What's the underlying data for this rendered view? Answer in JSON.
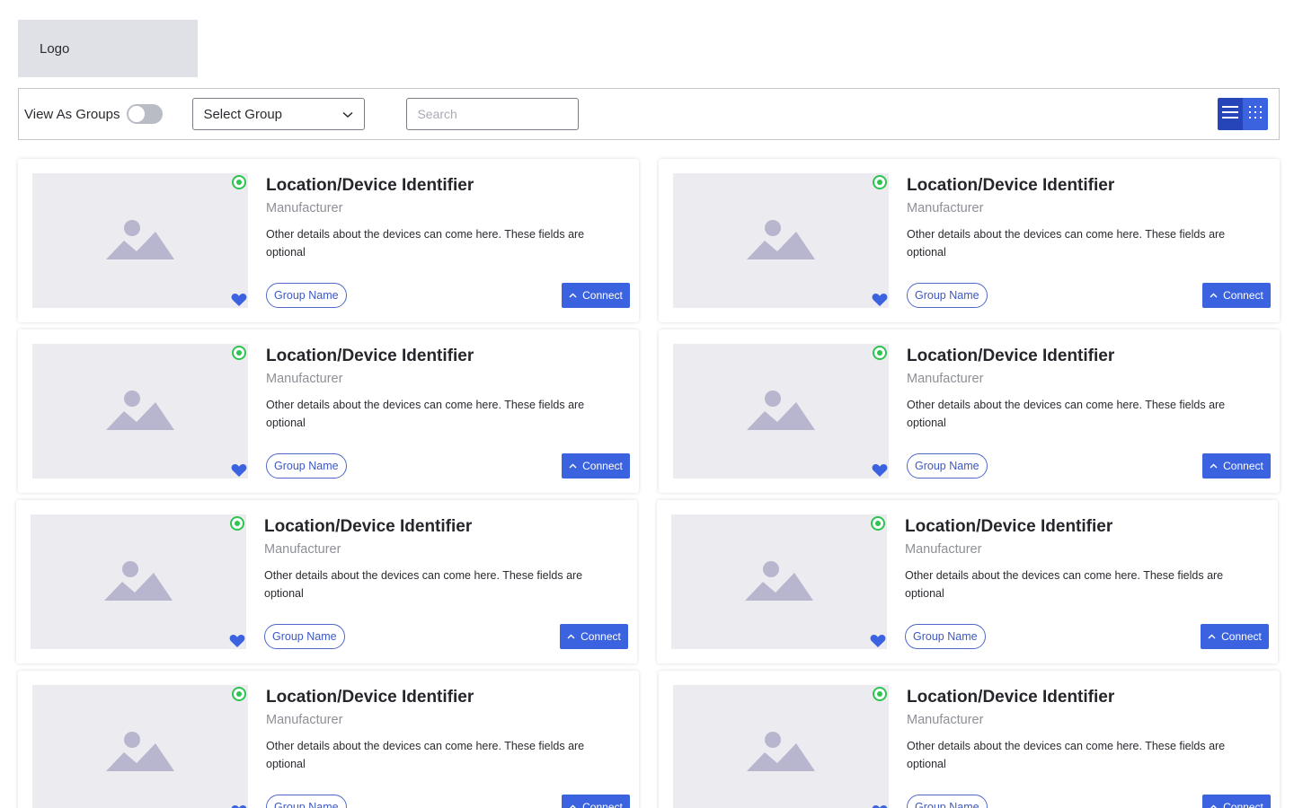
{
  "header": {
    "logo_label": "Logo"
  },
  "toolbar": {
    "toggle_label": "View As Groups",
    "toggle_on": false,
    "select_value": "Select Group",
    "search_placeholder": "Search",
    "active_view": "grid"
  },
  "colors": {
    "accent": "#3b63e0",
    "accent_dark": "#2545b8",
    "status_online": "#2ec452",
    "placeholder_bg": "#ecebf0"
  },
  "cards": [
    {
      "title": "Location/Device Identifier",
      "manufacturer": "Manufacturer",
      "details": "Other details about the devices can come here. These fields are optional",
      "group": "Group Name",
      "connect": "Connect"
    },
    {
      "title": "Location/Device Identifier",
      "manufacturer": "Manufacturer",
      "details": "Other details about the devices can come here. These fields are optional",
      "group": "Group Name",
      "connect": "Connect"
    },
    {
      "title": "Location/Device Identifier",
      "manufacturer": "Manufacturer",
      "details": "Other details about the devices can come here. These fields are optional",
      "group": "Group Name",
      "connect": "Connect"
    },
    {
      "title": "Location/Device Identifier",
      "manufacturer": "Manufacturer",
      "details": "Other details about the devices can come here. These fields are optional",
      "group": "Group Name",
      "connect": "Connect"
    },
    {
      "title": "Location/Device Identifier",
      "manufacturer": "Manufacturer",
      "details": "Other details about the devices can come here. These fields are optional",
      "group": "Group Name",
      "connect": "Connect"
    },
    {
      "title": "Location/Device Identifier",
      "manufacturer": "Manufacturer",
      "details": "Other details about the devices can come here. These fields are optional",
      "group": "Group Name",
      "connect": "Connect"
    },
    {
      "title": "Location/Device Identifier",
      "manufacturer": "Manufacturer",
      "details": "Other details about the devices can come here. These fields are optional",
      "group": "Group Name",
      "connect": "Connect"
    },
    {
      "title": "Location/Device Identifier",
      "manufacturer": "Manufacturer",
      "details": "Other details about the devices can come here. These fields are optional",
      "group": "Group Name",
      "connect": "Connect"
    }
  ]
}
